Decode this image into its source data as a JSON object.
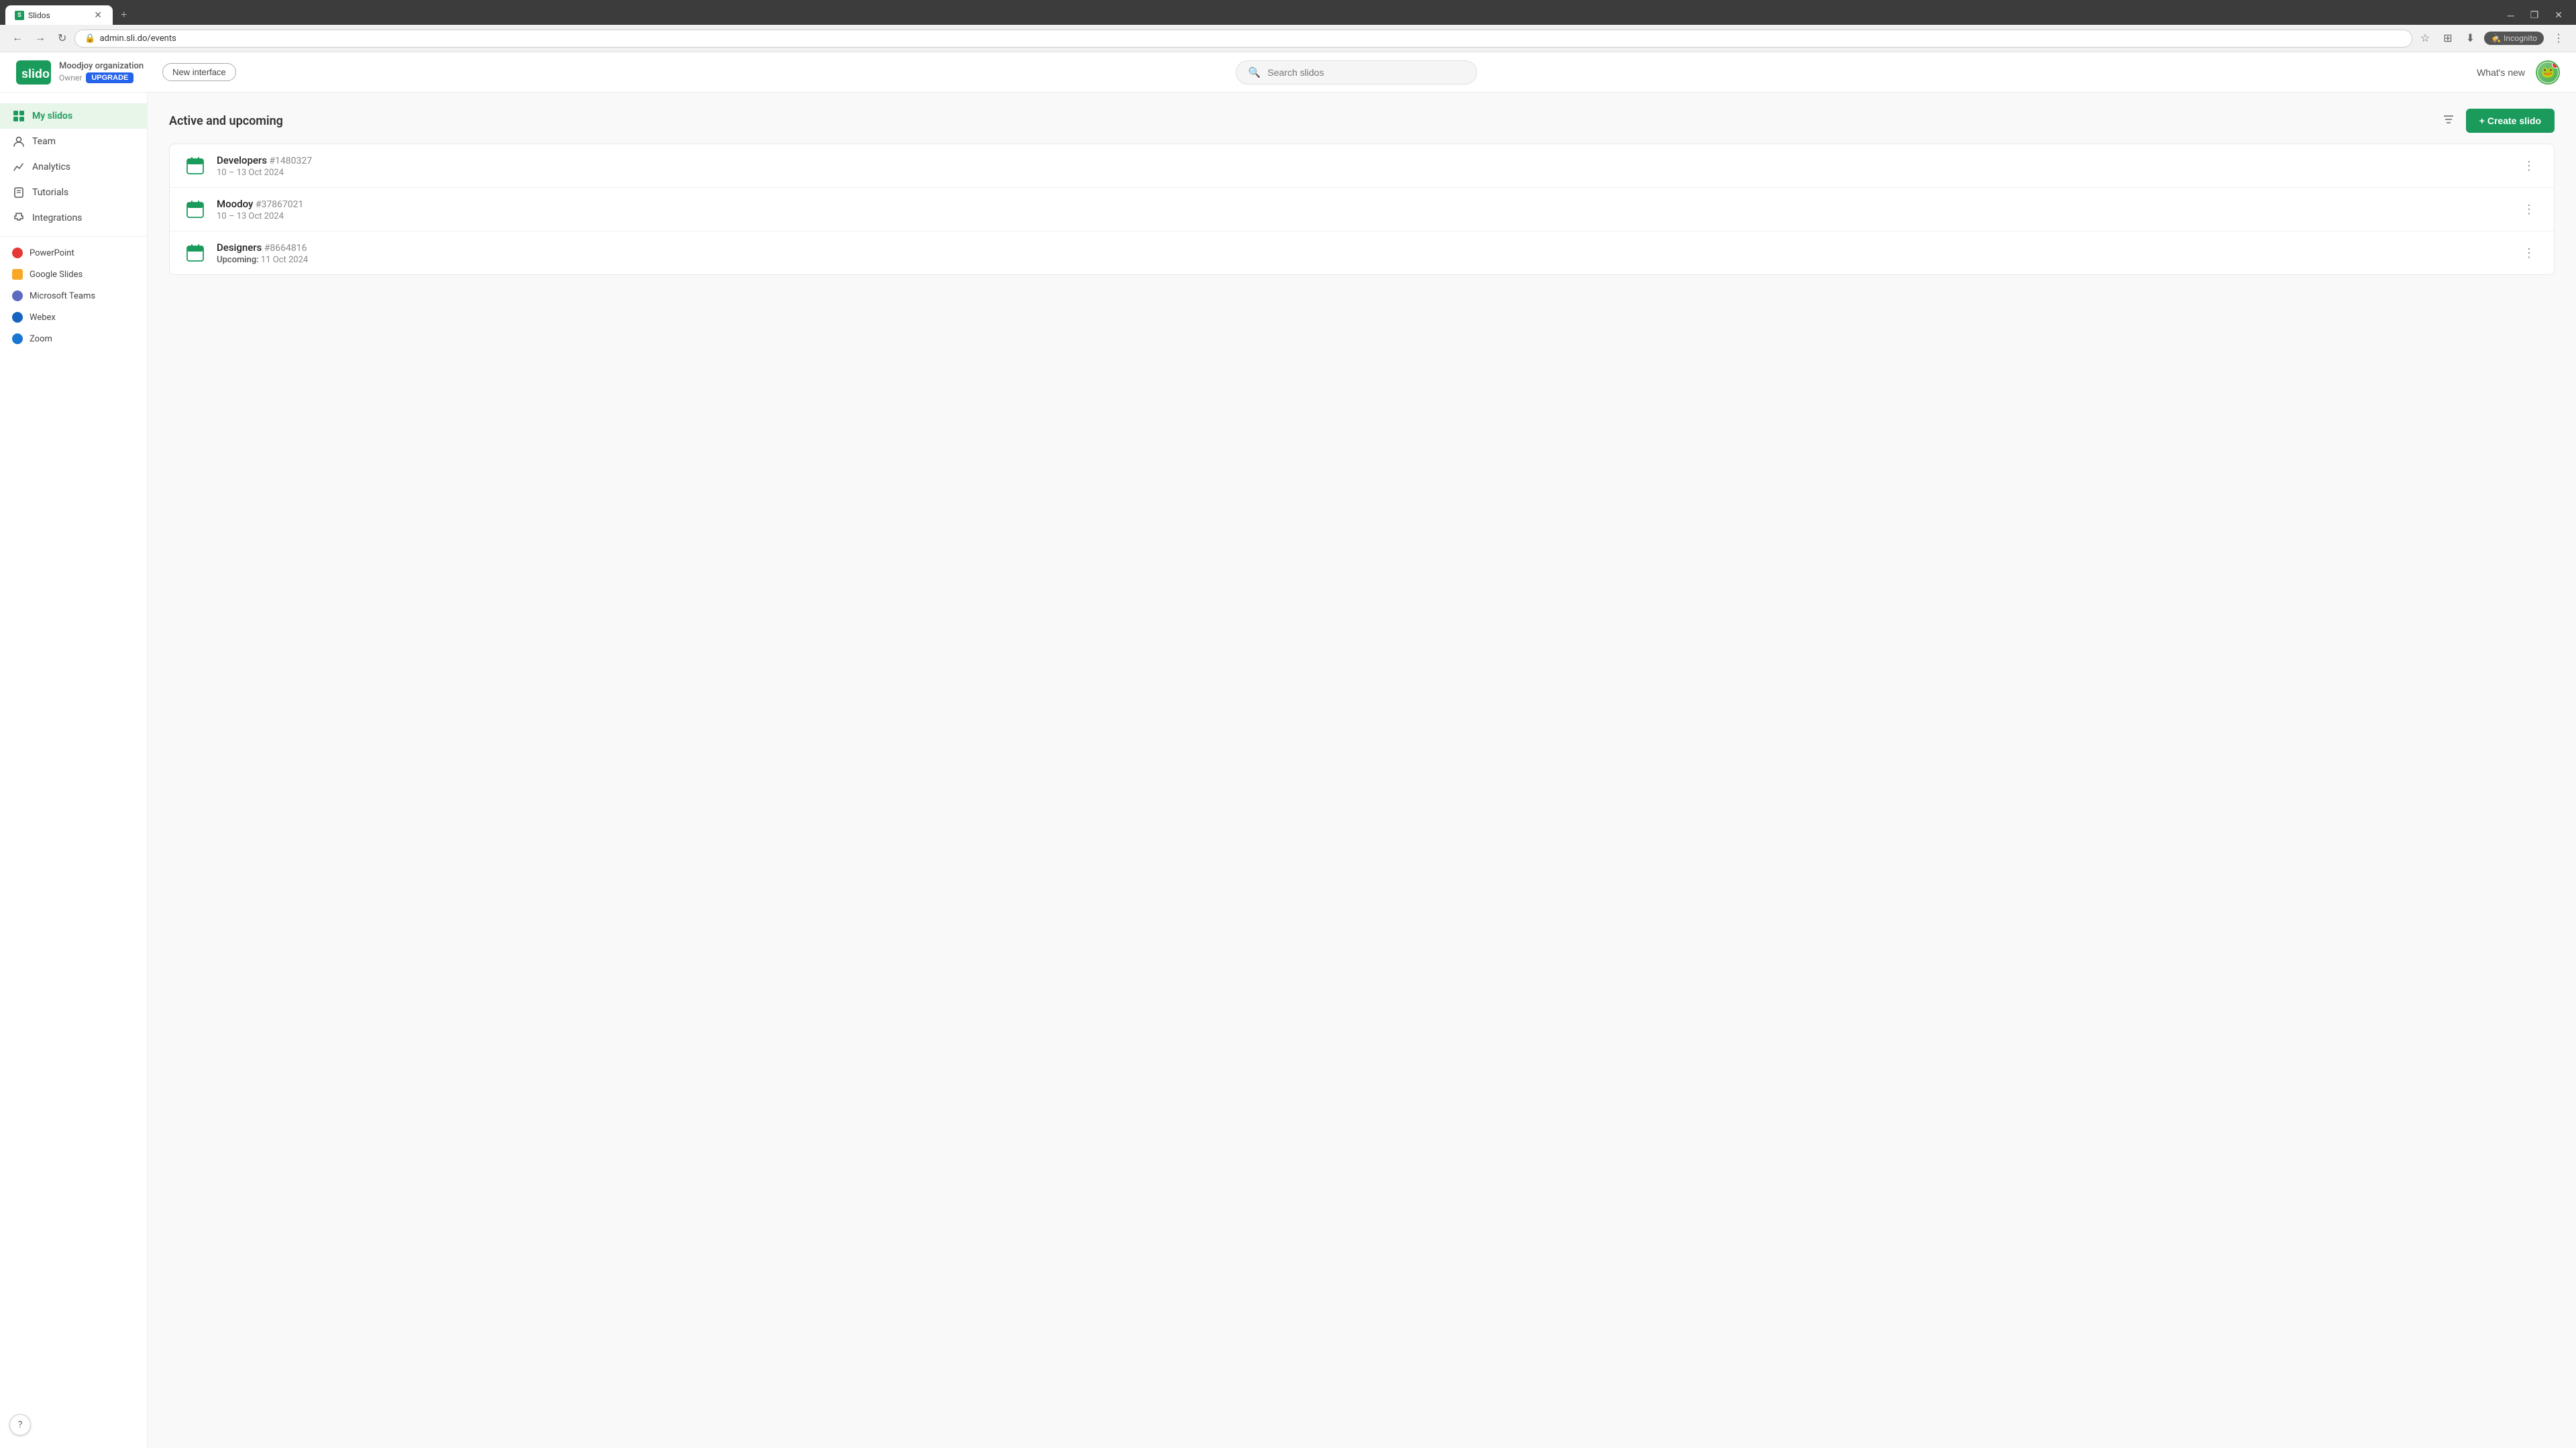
{
  "browser": {
    "tab_favicon": "S",
    "tab_title": "Slidos",
    "url": "admin.sli.do/events",
    "nav_back": "←",
    "nav_forward": "→",
    "nav_refresh": "↻",
    "incognito_label": "Incognito",
    "window_minimize": "─",
    "window_restore": "❐",
    "window_close": "✕"
  },
  "header": {
    "logo_text": "slido",
    "org_name": "Moodjoy organization",
    "org_role": "Owner",
    "upgrade_label": "UPGRADE",
    "new_interface_label": "New interface",
    "search_placeholder": "Search slidos",
    "whats_new_label": "What's new"
  },
  "sidebar": {
    "items": [
      {
        "id": "my-slidos",
        "label": "My slidos",
        "icon": "grid",
        "active": true
      },
      {
        "id": "team",
        "label": "Team",
        "icon": "person",
        "active": false
      },
      {
        "id": "analytics",
        "label": "Analytics",
        "icon": "chart",
        "active": false
      },
      {
        "id": "tutorials",
        "label": "Tutorials",
        "icon": "book",
        "active": false
      },
      {
        "id": "integrations",
        "label": "Integrations",
        "icon": "puzzle",
        "active": false
      }
    ],
    "integrations": [
      {
        "id": "powerpoint",
        "label": "PowerPoint",
        "color": "#e53935"
      },
      {
        "id": "google-slides",
        "label": "Google Slides",
        "color": "#f9a825"
      },
      {
        "id": "microsoft-teams",
        "label": "Microsoft Teams",
        "color": "#5c6bc0"
      },
      {
        "id": "webex",
        "label": "Webex",
        "color": "#1565c0"
      },
      {
        "id": "zoom",
        "label": "Zoom",
        "color": "#1976d2"
      }
    ],
    "help_label": "?"
  },
  "content": {
    "section_title": "Active and upcoming",
    "create_label": "+ Create slido",
    "events": [
      {
        "name": "Developers",
        "id": "#1480327",
        "date": "10 – 13 Oct 2024",
        "upcoming": false
      },
      {
        "name": "Moodoy",
        "id": "#37867021",
        "date": "10 – 13 Oct 2024",
        "upcoming": false
      },
      {
        "name": "Designers",
        "id": "#8664816",
        "date": "11 Oct 2024",
        "upcoming": true,
        "upcoming_label": "Upcoming:"
      }
    ]
  }
}
